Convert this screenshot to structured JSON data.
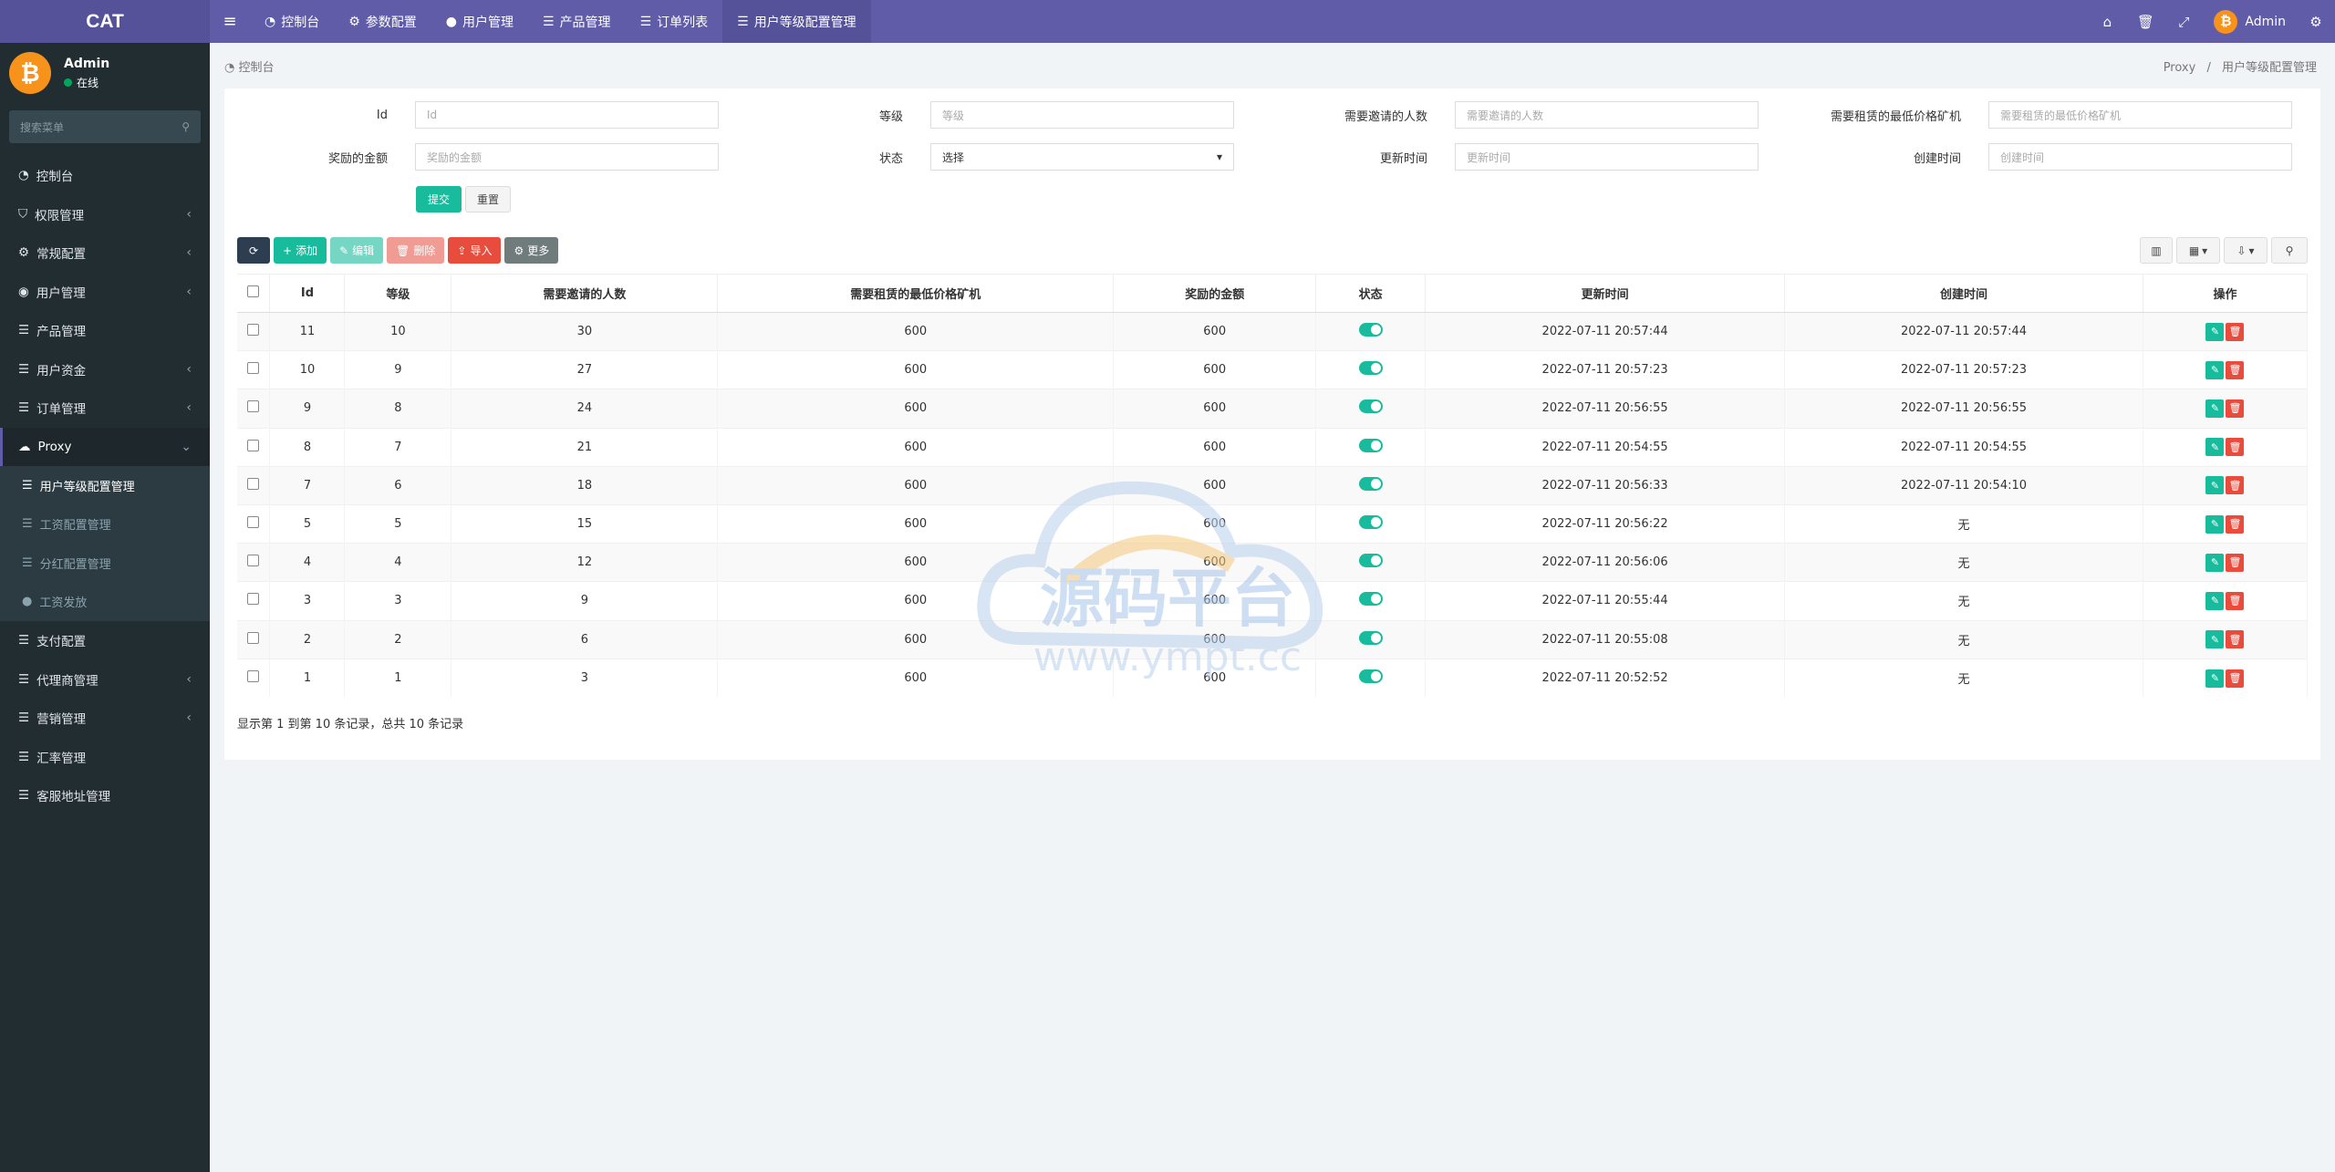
{
  "brand": "CAT",
  "colors": {
    "header": "#605ca8",
    "sidebar": "#222d32",
    "success": "#18bc9c",
    "danger": "#e74c3c"
  },
  "header": {
    "tabs": [
      {
        "label": "控制台",
        "icon": "dashboard-icon"
      },
      {
        "label": "参数配置",
        "icon": "cogs-icon"
      },
      {
        "label": "用户管理",
        "icon": "user-icon"
      },
      {
        "label": "产品管理",
        "icon": "list-icon"
      },
      {
        "label": "订单列表",
        "icon": "list-icon"
      },
      {
        "label": "用户等级配置管理",
        "icon": "list-icon"
      }
    ],
    "user": "Admin"
  },
  "sidebar": {
    "name": "Admin",
    "status": "在线",
    "search_placeholder": "搜索菜单",
    "items": [
      {
        "label": "控制台"
      },
      {
        "label": "权限管理"
      },
      {
        "label": "常规配置"
      },
      {
        "label": "用户管理"
      },
      {
        "label": "产品管理"
      },
      {
        "label": "用户资金"
      },
      {
        "label": "订单管理"
      },
      {
        "label": "Proxy"
      },
      {
        "label": "用户等级配置管理"
      },
      {
        "label": "工资配置管理"
      },
      {
        "label": "分红配置管理"
      },
      {
        "label": "工资发放"
      },
      {
        "label": "支付配置"
      },
      {
        "label": "代理商管理"
      },
      {
        "label": "营销管理"
      },
      {
        "label": "汇率管理"
      },
      {
        "label": "客服地址管理"
      }
    ]
  },
  "breadcrumb": {
    "left": "控制台",
    "right1": "Proxy",
    "sep": "/",
    "right2": "用户等级配置管理"
  },
  "form": {
    "id_label": "Id",
    "id_ph": "Id",
    "level_label": "等级",
    "level_ph": "等级",
    "invite_label": "需要邀请的人数",
    "invite_ph": "需要邀请的人数",
    "machine_label": "需要租赁的最低价格矿机",
    "machine_ph": "需要租赁的最低价格矿机",
    "reward_label": "奖励的金额",
    "reward_ph": "奖励的金额",
    "status_label": "状态",
    "status_value": "选择",
    "updated_label": "更新时间",
    "updated_ph": "更新时间",
    "created_label": "创建时间",
    "created_ph": "创建时间",
    "submit": "提交",
    "reset": "重置"
  },
  "toolbar": {
    "add": "添加",
    "edit": "编辑",
    "delete": "删除",
    "import": "导入",
    "more": "更多"
  },
  "table": {
    "headers": [
      "Id",
      "等级",
      "需要邀请的人数",
      "需要租赁的最低价格矿机",
      "奖励的金额",
      "状态",
      "更新时间",
      "创建时间",
      "操作"
    ],
    "rows": [
      [
        "11",
        "10",
        "30",
        "600",
        "600",
        "2022-07-11 20:57:44",
        "2022-07-11 20:57:44"
      ],
      [
        "10",
        "9",
        "27",
        "600",
        "600",
        "2022-07-11 20:57:23",
        "2022-07-11 20:57:23"
      ],
      [
        "9",
        "8",
        "24",
        "600",
        "600",
        "2022-07-11 20:56:55",
        "2022-07-11 20:56:55"
      ],
      [
        "8",
        "7",
        "21",
        "600",
        "600",
        "2022-07-11 20:54:55",
        "2022-07-11 20:54:55"
      ],
      [
        "7",
        "6",
        "18",
        "600",
        "600",
        "2022-07-11 20:56:33",
        "2022-07-11 20:54:10"
      ],
      [
        "5",
        "5",
        "15",
        "600",
        "600",
        "2022-07-11 20:56:22",
        "无"
      ],
      [
        "4",
        "4",
        "12",
        "600",
        "600",
        "2022-07-11 20:56:06",
        "无"
      ],
      [
        "3",
        "3",
        "9",
        "600",
        "600",
        "2022-07-11 20:55:44",
        "无"
      ],
      [
        "2",
        "2",
        "6",
        "600",
        "600",
        "2022-07-11 20:55:08",
        "无"
      ],
      [
        "1",
        "1",
        "3",
        "600",
        "600",
        "2022-07-11 20:52:52",
        "无"
      ]
    ]
  },
  "pagination_info": "显示第 1 到第 10 条记录，总共 10 条记录",
  "watermark": {
    "title": "源码平台",
    "url": "www.ympt.cc"
  }
}
